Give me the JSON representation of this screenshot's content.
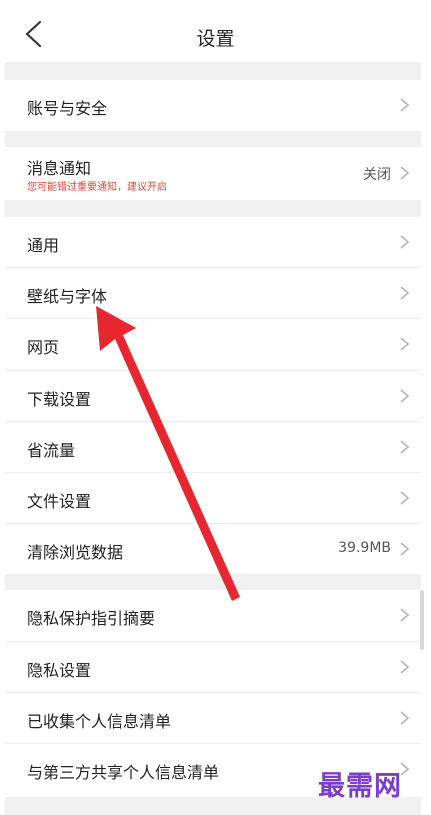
{
  "header": {
    "title": "设置"
  },
  "sections": [
    {
      "items": [
        {
          "label": "账号与安全",
          "value": ""
        }
      ]
    },
    {
      "items": [
        {
          "label": "消息通知",
          "sublabel": "您可能错过重要通知，建议开启",
          "value": "关闭"
        }
      ]
    },
    {
      "items": [
        {
          "label": "通用",
          "value": ""
        },
        {
          "label": "壁纸与字体",
          "value": ""
        },
        {
          "label": "网页",
          "value": ""
        },
        {
          "label": "下载设置",
          "value": ""
        },
        {
          "label": "省流量",
          "value": ""
        },
        {
          "label": "文件设置",
          "value": ""
        },
        {
          "label": "清除浏览数据",
          "value": "39.9MB"
        }
      ]
    },
    {
      "items": [
        {
          "label": "隐私保护指引摘要",
          "value": ""
        },
        {
          "label": "隐私设置",
          "value": ""
        },
        {
          "label": "已收集个人信息清单",
          "value": ""
        },
        {
          "label": "与第三方共享个人信息清单",
          "value": ""
        }
      ]
    }
  ],
  "annotation": {
    "color": "#e8262f"
  },
  "watermark": {
    "text": "最需网",
    "color": "#7a3ec9"
  }
}
